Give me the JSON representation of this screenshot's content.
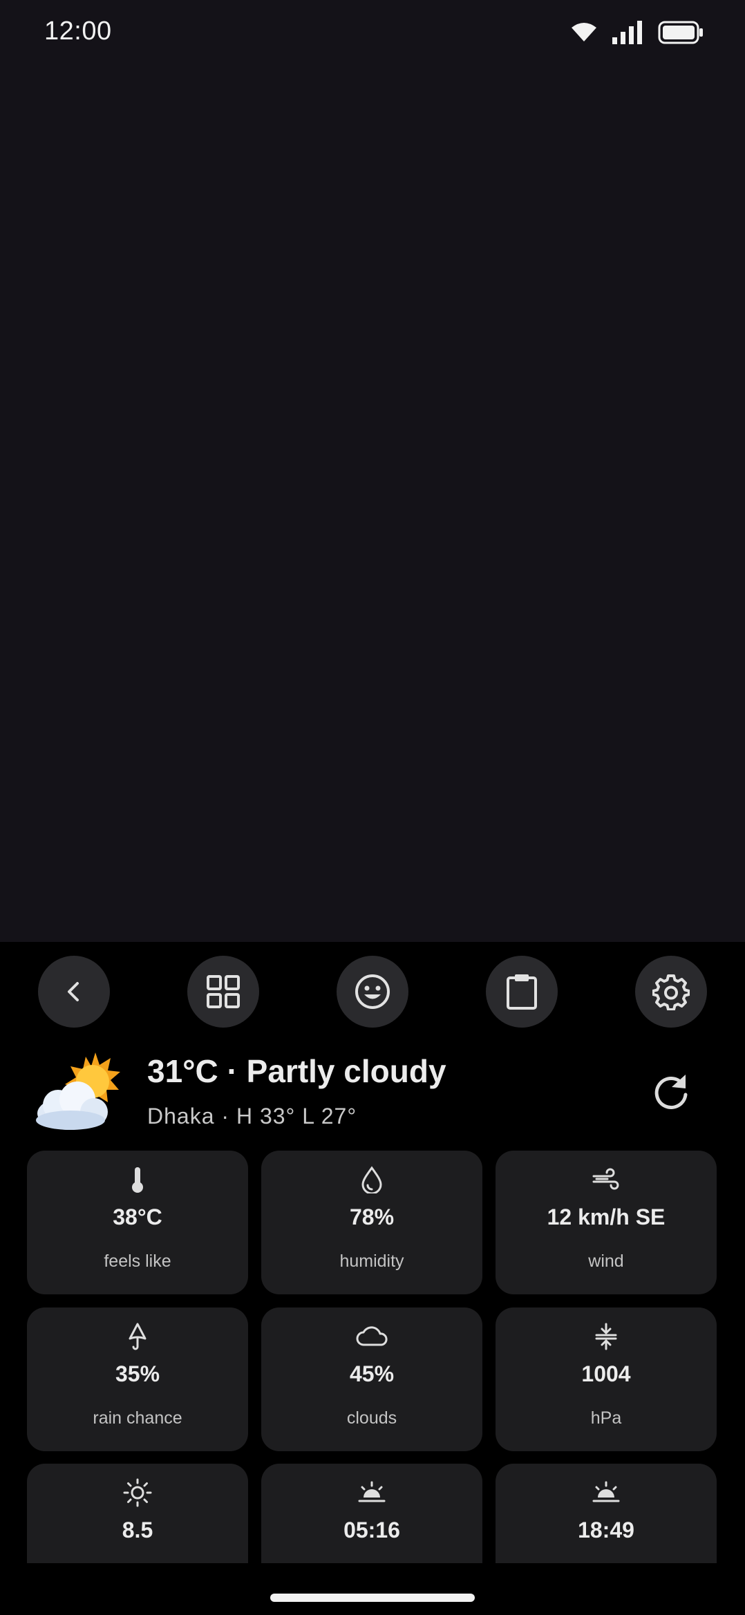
{
  "status_bar": {
    "time": "12:00",
    "icons": [
      "wifi-icon",
      "signal-icon",
      "battery-icon"
    ]
  },
  "toolbar": {
    "buttons": [
      {
        "name": "back-button",
        "icon": "chevron-left-icon"
      },
      {
        "name": "grid-button",
        "icon": "grid-icon"
      },
      {
        "name": "emoji-button",
        "icon": "emoji-icon"
      },
      {
        "name": "clipboard-button",
        "icon": "clipboard-icon"
      },
      {
        "name": "settings-button",
        "icon": "gear-icon"
      }
    ]
  },
  "weather": {
    "title": "31°C · Partly cloudy",
    "subtitle": "Dhaka · H 33° L 27°",
    "icon": "sun-behind-cloud",
    "refresh_icon": "refresh-icon"
  },
  "tiles": [
    {
      "icon": "thermometer-icon",
      "value": "38°C",
      "label": "feels like"
    },
    {
      "icon": "droplet-icon",
      "value": "78%",
      "label": "humidity"
    },
    {
      "icon": "wind-icon",
      "value": "12 km/h SE",
      "label": "wind"
    },
    {
      "icon": "umbrella-icon",
      "value": "35%",
      "label": "rain chance"
    },
    {
      "icon": "cloud-icon",
      "value": "45%",
      "label": "clouds"
    },
    {
      "icon": "pressure-icon",
      "value": "1004",
      "label": "hPa"
    },
    {
      "icon": "sun-icon",
      "value": "8.5",
      "label": ""
    },
    {
      "icon": "sunrise-icon",
      "value": "05:16",
      "label": ""
    },
    {
      "icon": "sunset-icon",
      "value": "18:49",
      "label": ""
    }
  ],
  "colors": {
    "app_background": "#141218",
    "panel_background": "#000000",
    "tile_background": "#1d1d1f",
    "button_background": "#2a2a2d",
    "text_primary": "#ececec",
    "text_secondary": "#c4c4c4"
  }
}
